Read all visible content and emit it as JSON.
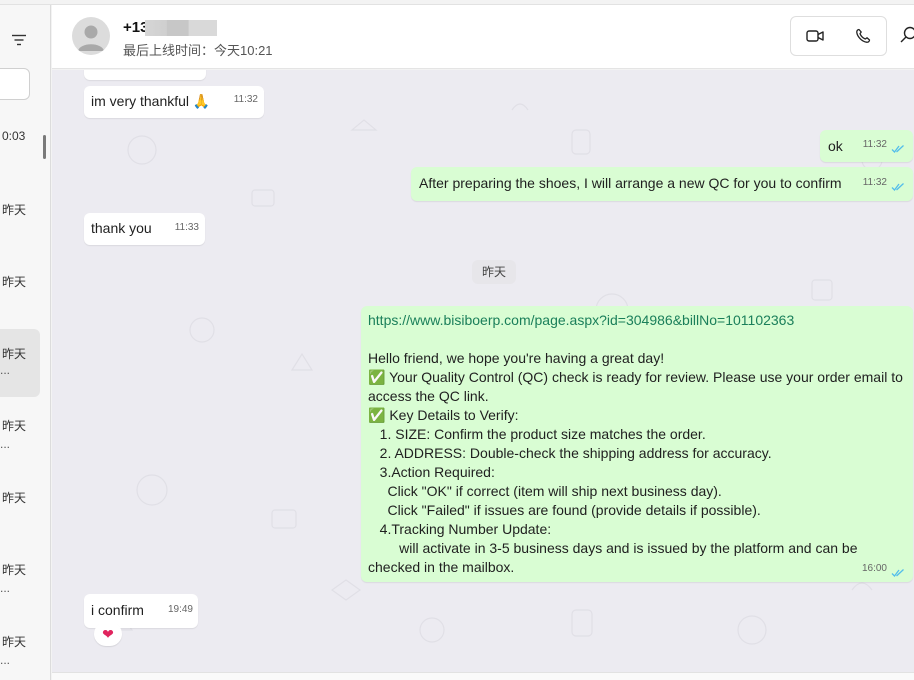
{
  "sidebar": {
    "chats": [
      {
        "time": "0:03",
        "snippet": ""
      },
      {
        "time": "昨天",
        "snippet": ""
      },
      {
        "time": "昨天",
        "snippet": ""
      },
      {
        "time": "昨天",
        "snippet": "..."
      },
      {
        "time": "昨天",
        "snippet": "..."
      },
      {
        "time": "昨天",
        "snippet": ""
      },
      {
        "time": "昨天",
        "snippet": "..."
      },
      {
        "time": "昨天",
        "snippet": "..."
      }
    ]
  },
  "header": {
    "name": "+13",
    "last_seen": "最后上线时间：今天10:21"
  },
  "messages": [
    {
      "text": "im very thankful 🙏",
      "time": "11:32"
    },
    {
      "text": "ok",
      "time": "11:32"
    },
    {
      "text": "After preparing the shoes, I will arrange a new QC for you to confirm",
      "time": "11:32"
    },
    {
      "text": "thank you",
      "time": "11:33"
    },
    {
      "link": "https://www.bisiboerp.com/page.aspx?id=304986&billNo=101102363",
      "text": "Hello friend, we hope you're having a great day!\n✅ Your Quality Control (QC) check is ready for review. Please use your order email to access the QC link.\n✅ Key Details to Verify:\n   1. SIZE: Confirm the product size matches the order.\n   2. ADDRESS: Double-check the shipping address for accuracy.\n   3.Action Required:\n     Click \"OK\" if correct (item will ship next business day).\n     Click \"Failed\" if issues are found (provide details if possible).\n   4.Tracking Number Update:\n        will activate in 3-5 business days and is issued by the platform and can be checked in the mailbox.",
      "time": "16:00"
    },
    {
      "text": "i confirm",
      "time": "19:49",
      "reaction": "❤"
    }
  ],
  "date_separator": "昨天",
  "colors": {
    "outgoing": "#d9fdd3",
    "incoming": "#ffffff",
    "tick": "#53bdeb",
    "link": "#1a7f5a"
  },
  "icons": {
    "filter": "filter-icon",
    "video": "video-call-icon",
    "voice": "phone-icon",
    "search": "search-icon",
    "read": "double-check-icon"
  }
}
